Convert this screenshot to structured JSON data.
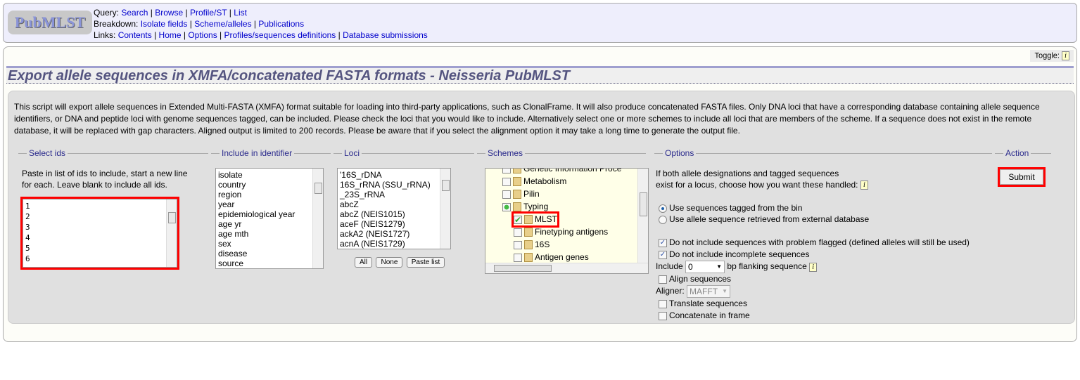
{
  "header": {
    "logo": "PubMLST",
    "query_label": "Query:",
    "query": [
      "Search",
      "Browse",
      "Profile/ST",
      "List"
    ],
    "breakdown_label": "Breakdown:",
    "breakdown": [
      "Isolate fields",
      "Scheme/alleles",
      "Publications"
    ],
    "links_label": "Links:",
    "links": [
      "Contents",
      "Home",
      "Options",
      "Profiles/sequences definitions",
      "Database submissions"
    ]
  },
  "toggle_label": "Toggle:",
  "title": "Export allele sequences in XMFA/concatenated FASTA formats - Neisseria PubMLST",
  "description": "This script will export allele sequences in Extended Multi-FASTA (XMFA) format suitable for loading into third-party applications, such as ClonalFrame. It will also produce concatenated FASTA files. Only DNA loci that have a corresponding database containing allele sequence identifiers, or DNA and peptide loci with genome sequences tagged, can be included. Please check the loci that you would like to include. Alternatively select one or more schemes to include all loci that are members of the scheme. If a sequence does not exist in the remote database, it will be replaced with gap characters. Aligned output is limited to 200 records. Please be aware that if you select the alignment option it may take a long time to generate the output file.",
  "select_ids": {
    "legend": "Select ids",
    "help": "Paste in list of ids to include, start a new line for each. Leave blank to include all ids.",
    "ids": [
      "1",
      "2",
      "3",
      "4",
      "5",
      "6"
    ]
  },
  "identifier": {
    "legend": "Include in identifier",
    "items": [
      "isolate",
      "country",
      "region",
      "year",
      "epidemiological year",
      "age yr",
      "age mth",
      "sex",
      "disease",
      "source"
    ]
  },
  "loci": {
    "legend": "Loci",
    "items": [
      "'16S_rDNA",
      "16S_rRNA (SSU_rRNA)",
      "_23S_rRNA",
      "abcZ",
      "abcZ (NEIS1015)",
      "aceF (NEIS1279)",
      "ackA2 (NEIS1727)",
      "acnA (NEIS1729)"
    ],
    "buttons": [
      "All",
      "None",
      "Paste list"
    ]
  },
  "schemes": {
    "legend": "Schemes",
    "items": [
      {
        "label": "Genetic Information Proce",
        "state": "unchecked"
      },
      {
        "label": "Metabolism",
        "state": "unchecked"
      },
      {
        "label": "Pilin",
        "state": "unchecked"
      },
      {
        "label": "Typing",
        "state": "partial"
      },
      {
        "label": "MLST",
        "state": "checked"
      },
      {
        "label": "Finetyping antigens",
        "state": "unchecked"
      },
      {
        "label": "16S",
        "state": "unchecked"
      },
      {
        "label": "Antigen genes",
        "state": "unchecked"
      }
    ]
  },
  "options": {
    "legend": "Options",
    "intro_line1": "If both allele designations and tagged sequences",
    "intro_line2": "exist for a locus, choose how you want these handled:",
    "radio_bin": "Use sequences tagged from the bin",
    "radio_bin_selected": true,
    "radio_ext": "Use allele sequence retrieved from external database",
    "cb_flagged": "Do not include sequences with problem flagged (defined alleles will still be used)",
    "cb_flagged_checked": true,
    "cb_incomplete": "Do not include incomplete sequences",
    "cb_incomplete_checked": true,
    "include_label": "Include",
    "flanking_value": "0",
    "flanking_label": "bp flanking sequence",
    "align": "Align sequences",
    "aligner_label": "Aligner:",
    "aligner_value": "MAFFT",
    "translate": "Translate sequences",
    "concatenate": "Concatenate in frame"
  },
  "action": {
    "legend": "Action",
    "submit": "Submit"
  },
  "colors": {
    "highlight": "#ff0000",
    "link": "#0000cc",
    "legend": "#2a2a8c"
  }
}
